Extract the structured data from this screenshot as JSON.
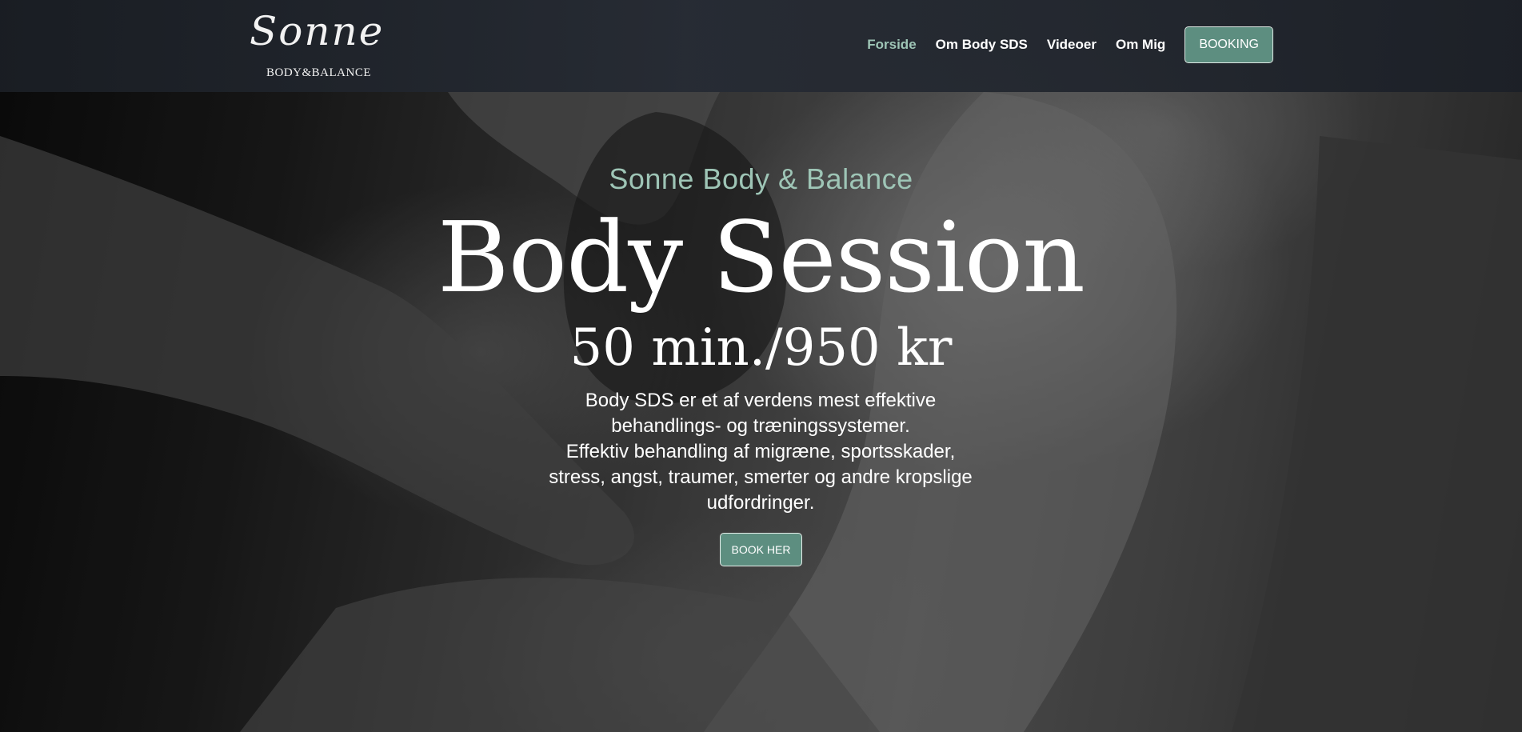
{
  "header": {
    "logo": {
      "script": "Sonne",
      "subtitle": "BODY&BALANCE"
    },
    "nav": [
      {
        "label": "Forside",
        "active": true
      },
      {
        "label": "Om Body SDS",
        "active": false
      },
      {
        "label": "Videoer",
        "active": false
      },
      {
        "label": "Om Mig",
        "active": false
      }
    ],
    "booking_label": "BOOKING"
  },
  "hero": {
    "eyebrow": "Sonne Body & Balance",
    "headline": "Body Session",
    "price": "50 min./950 kr",
    "description_lines": [
      "Body SDS er et af verdens mest effektive",
      "behandlings- og træningssystemer.",
      "Effektiv behandling af migræne, sportsskader,",
      "stress, angst, traumer, smerter og andre kropslige",
      "udfordringer."
    ],
    "cta_label": "BOOK HER"
  },
  "colors": {
    "accent": "#9ec5b6",
    "button": "#5d8e80",
    "header_bg": "#22262e"
  }
}
